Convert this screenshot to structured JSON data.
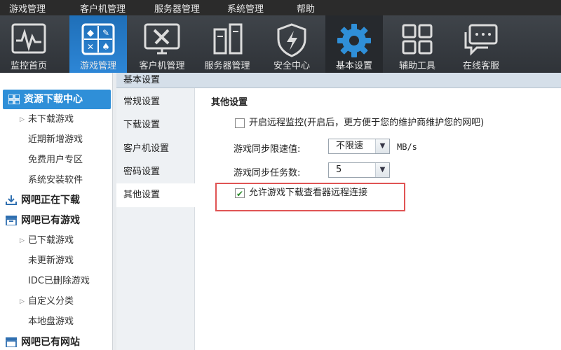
{
  "menu": [
    "游戏管理",
    "客户机管理",
    "服务器管理",
    "系统管理",
    "帮助"
  ],
  "toolbar": [
    {
      "label": "监控首页",
      "icon": "monitor-icon",
      "state": "normal"
    },
    {
      "label": "游戏管理",
      "icon": "game-icon",
      "state": "active"
    },
    {
      "label": "客户机管理",
      "icon": "client-tools-icon",
      "state": "normal"
    },
    {
      "label": "服务器管理",
      "icon": "server-icon",
      "state": "normal"
    },
    {
      "label": "安全中心",
      "icon": "shield-icon",
      "state": "normal"
    },
    {
      "label": "基本设置",
      "icon": "gear-icon",
      "state": "dark"
    },
    {
      "label": "辅助工具",
      "icon": "grid-icon",
      "state": "normal"
    },
    {
      "label": "在线客服",
      "icon": "chat-icon",
      "state": "normal"
    }
  ],
  "sidebar": [
    {
      "label": "资源下载中心",
      "type": "header",
      "active": true
    },
    {
      "label": "未下载游戏",
      "type": "sub",
      "arrow": true
    },
    {
      "label": "近期新增游戏",
      "type": "sub"
    },
    {
      "label": "免费用户专区",
      "type": "sub"
    },
    {
      "label": "系统安装软件",
      "type": "sub"
    },
    {
      "label": "网吧正在下载",
      "type": "header"
    },
    {
      "label": "网吧已有游戏",
      "type": "header"
    },
    {
      "label": "已下载游戏",
      "type": "sub",
      "arrow": true
    },
    {
      "label": "未更新游戏",
      "type": "sub"
    },
    {
      "label": "IDC已删除游戏",
      "type": "sub"
    },
    {
      "label": "自定义分类",
      "type": "sub",
      "arrow": true
    },
    {
      "label": "本地盘游戏",
      "type": "sub"
    },
    {
      "label": "网吧已有网站",
      "type": "header"
    }
  ],
  "panel_title": "基本设置",
  "settings_nav": [
    "常规设置",
    "下载设置",
    "客户机设置",
    "密码设置",
    "其他设置"
  ],
  "settings_nav_active": 4,
  "section_title": "其他设置",
  "remote_monitor": {
    "label": "开启远程监控(开启后，更方便于您的维护商维护您的网吧)",
    "checked": false
  },
  "sync_speed": {
    "label": "游戏同步限速值:",
    "value": "不限速",
    "unit": "MB/s"
  },
  "sync_tasks": {
    "label": "游戏同步任务数:",
    "value": "5"
  },
  "allow_remote": {
    "label": "允许游戏下载查看器远程连接",
    "checked": true
  },
  "colors": {
    "accent": "#2f8fd8",
    "highlight_border": "#e05454",
    "toolbar_bg": "#3a3e43"
  }
}
